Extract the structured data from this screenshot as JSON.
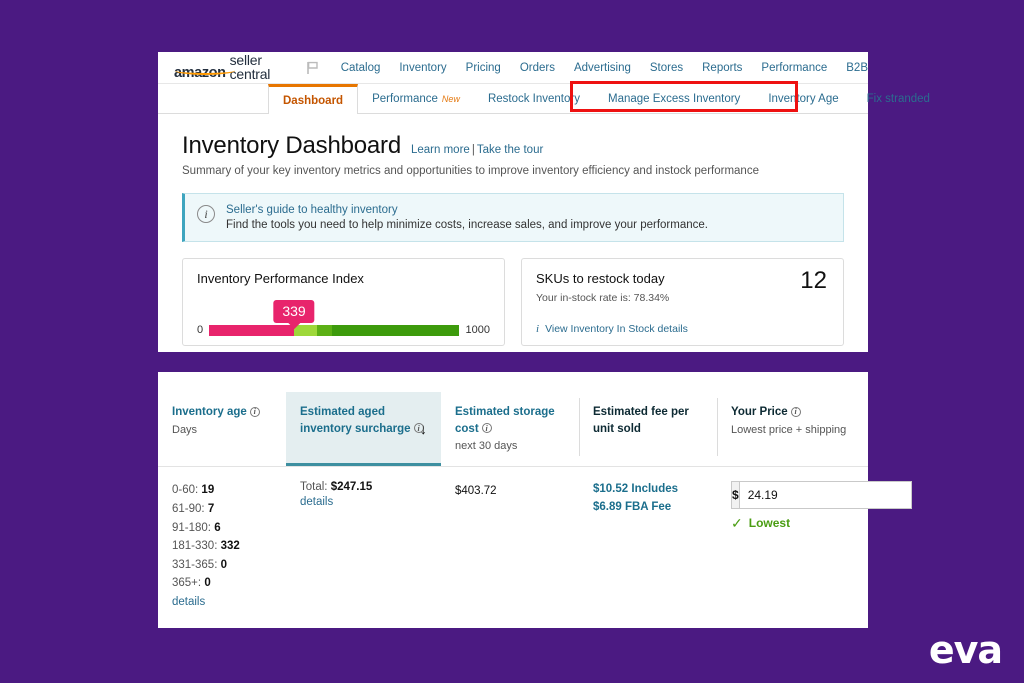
{
  "theme": {
    "background": "#4b1a82",
    "accent_orange": "#e77600",
    "link_blue": "#2b6c8f",
    "teal": "#3d8fa0",
    "highlight_red": "#ee1111",
    "green": "#4a9d12",
    "gauge_red": "#e8246c"
  },
  "global_nav": {
    "brand_amazon": "amazon",
    "brand_sub": "seller central",
    "flag_icon": "flag-icon",
    "items": [
      {
        "label": "Catalog"
      },
      {
        "label": "Inventory"
      },
      {
        "label": "Pricing"
      },
      {
        "label": "Orders"
      },
      {
        "label": "Advertising"
      },
      {
        "label": "Stores"
      },
      {
        "label": "Reports"
      },
      {
        "label": "Performance"
      },
      {
        "label": "B2B"
      }
    ]
  },
  "sub_tabs": [
    {
      "label": "Dashboard",
      "active": true,
      "badge": ""
    },
    {
      "label": "Performance",
      "active": false,
      "badge": "New"
    },
    {
      "label": "Restock Inventory",
      "active": false,
      "badge": ""
    },
    {
      "label": "Manage Excess Inventory",
      "active": false,
      "badge": ""
    },
    {
      "label": "Inventory Age",
      "active": false,
      "badge": ""
    },
    {
      "label": "Fix stranded",
      "active": false,
      "badge": ""
    }
  ],
  "page": {
    "title": "Inventory Dashboard",
    "learn_more": "Learn more",
    "separator": "|",
    "take_tour": "Take the tour",
    "subtitle": "Summary of your key inventory metrics and opportunities to improve inventory efficiency and instock performance"
  },
  "banner": {
    "icon": "info-icon",
    "title": "Seller's guide to healthy inventory",
    "text": "Find the tools you need to help minimize costs, increase sales, and improve your performance."
  },
  "cards": {
    "ipi": {
      "title": "Inventory Performance Index",
      "score": "339",
      "min": "0",
      "max": "1000"
    },
    "restock": {
      "title": "SKUs to restock today",
      "count": "12",
      "instock_text": "Your in-stock rate is: 78.34%",
      "link_icon": "info-icon",
      "link": "View Inventory In Stock details"
    }
  },
  "chart_data": {
    "type": "bar",
    "title": "Inventory Performance Index",
    "categories": [
      "IPI score"
    ],
    "values": [
      339
    ],
    "xlabel": "",
    "ylabel": "",
    "ylim": [
      0,
      1000
    ],
    "annotations": [
      "339"
    ],
    "segments": [
      {
        "from": 0,
        "to": 339,
        "color": "#e8246c"
      },
      {
        "from": 339,
        "to": 430,
        "color": "#9ed83a"
      },
      {
        "from": 430,
        "to": 490,
        "color": "#5cb015"
      },
      {
        "from": 490,
        "to": 1000,
        "color": "#3d9b0c"
      }
    ]
  },
  "table": {
    "columns": [
      {
        "title": "Inventory age",
        "has_info": true,
        "sub": "Days",
        "style": "link",
        "selected": false,
        "sort_arrow": ""
      },
      {
        "title": "Estimated aged inventory surcharge",
        "has_info": true,
        "sub": "",
        "style": "link",
        "selected": true,
        "sort_arrow": "↓"
      },
      {
        "title": "Estimated storage cost",
        "has_info": true,
        "sub": "next 30 days",
        "style": "link",
        "selected": false,
        "sort_arrow": ""
      },
      {
        "title": "Estimated fee per unit sold",
        "has_info": false,
        "sub": "",
        "style": "plain",
        "selected": false,
        "sort_arrow": ""
      },
      {
        "title": "Your Price",
        "has_info": true,
        "sub": "Lowest price + shipping",
        "style": "plain",
        "selected": false,
        "sort_arrow": ""
      }
    ],
    "inventory_age": {
      "buckets": [
        {
          "range": "0-60:",
          "value": "19"
        },
        {
          "range": "61-90:",
          "value": "7"
        },
        {
          "range": "91-180:",
          "value": "6"
        },
        {
          "range": "181-330:",
          "value": "332"
        },
        {
          "range": "331-365:",
          "value": "0"
        },
        {
          "range": "365+:",
          "value": "0"
        }
      ],
      "details_link": "details"
    },
    "aged_surcharge": {
      "total_label": "Total:",
      "total_value": "$247.15",
      "details_link": "details"
    },
    "storage_cost": {
      "value": "$403.72"
    },
    "fee_per_unit": {
      "line1": "$10.52 Includes",
      "line2": "$6.89 FBA Fee"
    },
    "your_price": {
      "currency": "$",
      "value": "24.19",
      "check_icon": "check-icon",
      "status": "Lowest"
    }
  },
  "watermark": {
    "logo_text": "eva"
  }
}
